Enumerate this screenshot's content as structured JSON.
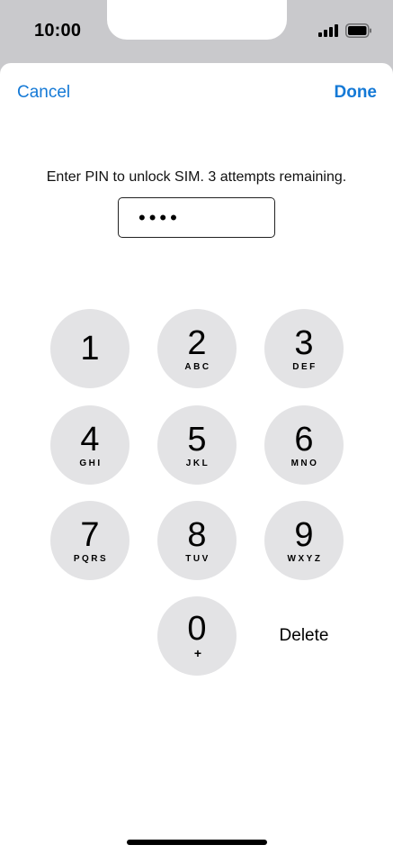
{
  "status": {
    "time": "10:00",
    "signal_icon": "cellular-signal-icon",
    "battery_icon": "battery-icon"
  },
  "nav": {
    "cancel_label": "Cancel",
    "done_label": "Done"
  },
  "prompt": "Enter PIN to unlock SIM. 3 attempts remaining.",
  "pin_field": {
    "value": "••••"
  },
  "keypad": {
    "keys": [
      {
        "digit": "1",
        "letters": ""
      },
      {
        "digit": "2",
        "letters": "ABC"
      },
      {
        "digit": "3",
        "letters": "DEF"
      },
      {
        "digit": "4",
        "letters": "GHI"
      },
      {
        "digit": "5",
        "letters": "JKL"
      },
      {
        "digit": "6",
        "letters": "MNO"
      },
      {
        "digit": "7",
        "letters": "PQRS"
      },
      {
        "digit": "8",
        "letters": "TUV"
      },
      {
        "digit": "9",
        "letters": "WXYZ"
      },
      {
        "digit": "0",
        "letters": "+"
      }
    ],
    "delete_label": "Delete"
  },
  "colors": {
    "accent": "#1479d6",
    "key_background": "#e3e3e5",
    "status_background": "#c9c9cc"
  }
}
